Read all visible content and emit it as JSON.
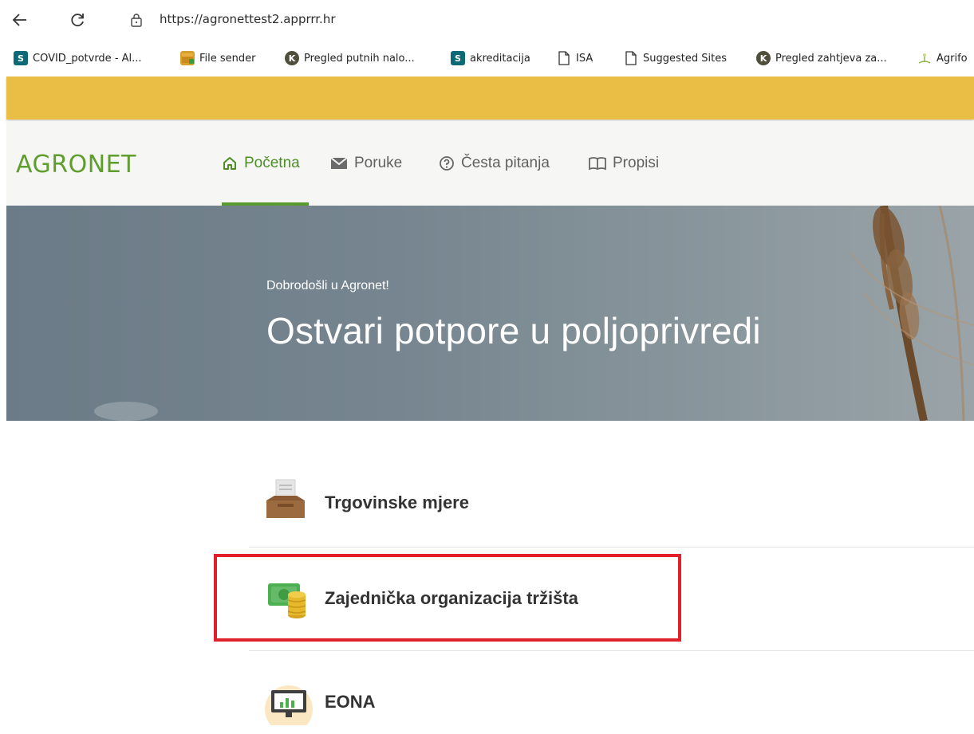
{
  "browser": {
    "url": "https://agronettest2.apprrr.hr",
    "bookmarks": [
      {
        "label": "COVID_potvrde - Al...",
        "icon": "sharepoint-icon",
        "icon_char": "S"
      },
      {
        "label": "File sender",
        "icon": "package-icon",
        "icon_char": ""
      },
      {
        "label": "Pregled putnih nalo...",
        "icon": "k-logo-icon",
        "icon_char": "K"
      },
      {
        "label": "akreditacija",
        "icon": "sharepoint-icon",
        "icon_char": "S"
      },
      {
        "label": "ISA",
        "icon": "document-icon",
        "icon_char": ""
      },
      {
        "label": "Suggested Sites",
        "icon": "document-icon",
        "icon_char": ""
      },
      {
        "label": "Pregled zahtjeva za...",
        "icon": "k-logo-icon",
        "icon_char": "K"
      },
      {
        "label": "Agrifo",
        "icon": "agri-icon",
        "icon_char": ""
      }
    ]
  },
  "header": {
    "logo": "AGRONET",
    "menu": [
      {
        "label": "Početna",
        "icon": "home-icon",
        "active": true
      },
      {
        "label": "Poruke",
        "icon": "mail-icon",
        "active": false
      },
      {
        "label": "Česta pitanja",
        "icon": "help-circle-icon",
        "active": false
      },
      {
        "label": "Propisi",
        "icon": "book-icon",
        "active": false
      }
    ]
  },
  "hero": {
    "subtitle": "Dobrodošli u Agronet!",
    "title": "Ostvari potpore u poljoprivredi"
  },
  "list": [
    {
      "label": "Trgovinske mjere",
      "icon": "inbox-tray-icon"
    },
    {
      "label": "Zajednička organizacija tržišta",
      "icon": "money-coins-icon",
      "highlighted": true
    },
    {
      "label": "EONA",
      "icon": "monitor-chart-icon"
    }
  ],
  "colors": {
    "accent_green": "#5a9b2f",
    "banner_yellow": "#eabd44",
    "highlight_red": "#e0202a"
  }
}
